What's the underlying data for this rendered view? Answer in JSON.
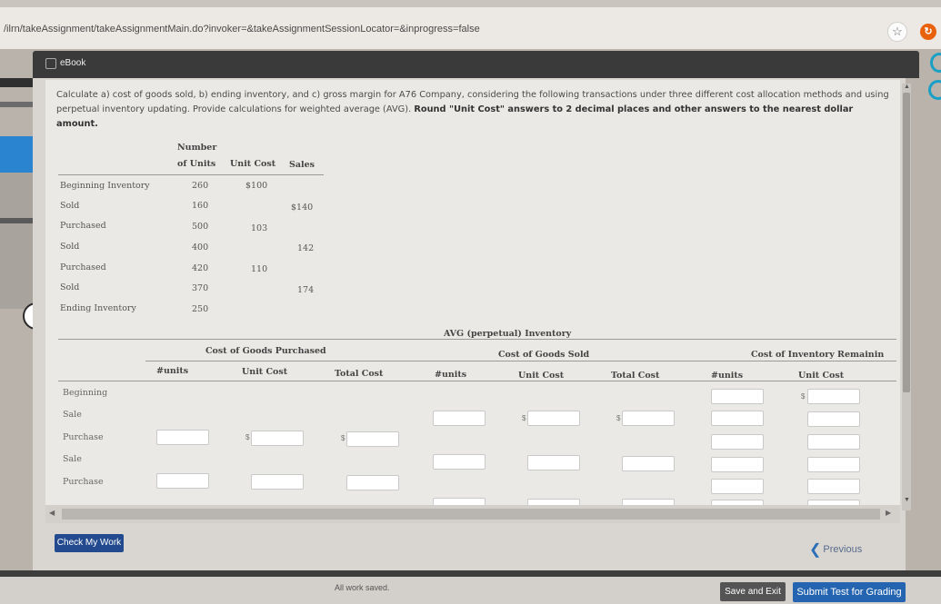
{
  "browser": {
    "url": "/ilrn/takeAssignment/takeAssignmentMain.do?invoker=&takeAssignmentSessionLocator=&inprogress=false",
    "star_icon": "star-icon"
  },
  "modal": {
    "title": "eBook"
  },
  "problem": {
    "text_main": "Calculate a) cost of goods sold, b) ending inventory, and c) gross margin for A76 Company, considering the following transactions under three different cost allocation methods and using perpetual inventory updating. Provide calculations for weighted average (AVG).",
    "text_bold": "Round \"Unit Cost\" answers to 2 decimal places and other answers to the nearest dollar amount."
  },
  "given": {
    "headers": {
      "number": "Number",
      "of_units": "of Units",
      "unit_cost": "Unit Cost",
      "sales": "Sales"
    },
    "rows": [
      {
        "label": "Beginning Inventory",
        "units": "260",
        "unit_cost": "$100",
        "sales": ""
      },
      {
        "label": "Sold",
        "units": "160",
        "unit_cost": "",
        "sales": "$140"
      },
      {
        "label": "Purchased",
        "units": "500",
        "unit_cost": "103",
        "sales": ""
      },
      {
        "label": "Sold",
        "units": "400",
        "unit_cost": "",
        "sales": "142"
      },
      {
        "label": "Purchased",
        "units": "420",
        "unit_cost": "110",
        "sales": ""
      },
      {
        "label": "Sold",
        "units": "370",
        "unit_cost": "",
        "sales": "174"
      },
      {
        "label": "Ending Inventory",
        "units": "250",
        "unit_cost": "",
        "sales": ""
      }
    ]
  },
  "avg_table": {
    "title": "AVG (perpetual) Inventory",
    "groups": {
      "purchased": "Cost of Goods Purchased",
      "sold": "Cost of Goods Sold",
      "remaining": "Cost of Inventory Remainin"
    },
    "col_headers": [
      "#units",
      "Unit Cost",
      "Total Cost",
      "#units",
      "Unit Cost",
      "Total Cost",
      "#units",
      "Unit Cost"
    ],
    "rows": [
      "Beginning",
      "Sale",
      "Purchase",
      "Sale",
      "Purchase"
    ],
    "currency": "$"
  },
  "buttons": {
    "check": "Check My Work",
    "previous": "Previous",
    "save_exit": "Save and Exit",
    "submit": "Submit Test for Grading"
  },
  "status": {
    "saved": "All work saved."
  }
}
